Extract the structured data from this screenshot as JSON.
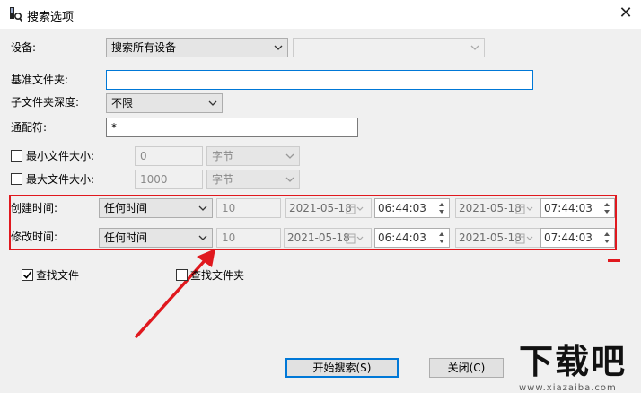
{
  "window": {
    "title": "搜索选项",
    "close_glyph": "✕"
  },
  "labels": {
    "device": "设备:",
    "base_folder": "基准文件夹:",
    "subfolder_depth": "子文件夹深度:",
    "wildcard": "通配符:",
    "min_size": "最小文件大小:",
    "max_size": "最大文件大小:",
    "created": "创建时间:",
    "modified": "修改时间:"
  },
  "fields": {
    "device_select": "搜索所有设备",
    "device_sub_select": "",
    "base_folder": "",
    "subfolder_depth": "不限",
    "wildcard": "*",
    "min_size": "0",
    "min_size_unit": "字节",
    "max_size": "1000",
    "max_size_unit": "字节"
  },
  "checkboxes": {
    "min_size_checked": false,
    "max_size_checked": false,
    "find_files": {
      "label": "查找文件",
      "checked": true
    },
    "find_folders": {
      "label": "查找文件夹",
      "checked": false
    }
  },
  "time_rows": {
    "created": {
      "mode": "任何时间",
      "count": "10",
      "from_date": "2021-05-18",
      "from_time": "06:44:03",
      "to_date": "2021-05-18",
      "to_time": "07:44:03"
    },
    "modified": {
      "mode": "任何时间",
      "count": "10",
      "from_date": "2021-05-18",
      "from_time": "06:44:03",
      "to_date": "2021-05-18",
      "to_time": "07:44:03"
    }
  },
  "buttons": {
    "start": "开始搜索(S)",
    "close": "关闭(C)"
  },
  "watermark": {
    "logo": "下载吧",
    "url": "www.xiazaiba.com"
  },
  "colors": {
    "annotation_red": "#e0181e",
    "focus_blue": "#0078d7"
  }
}
